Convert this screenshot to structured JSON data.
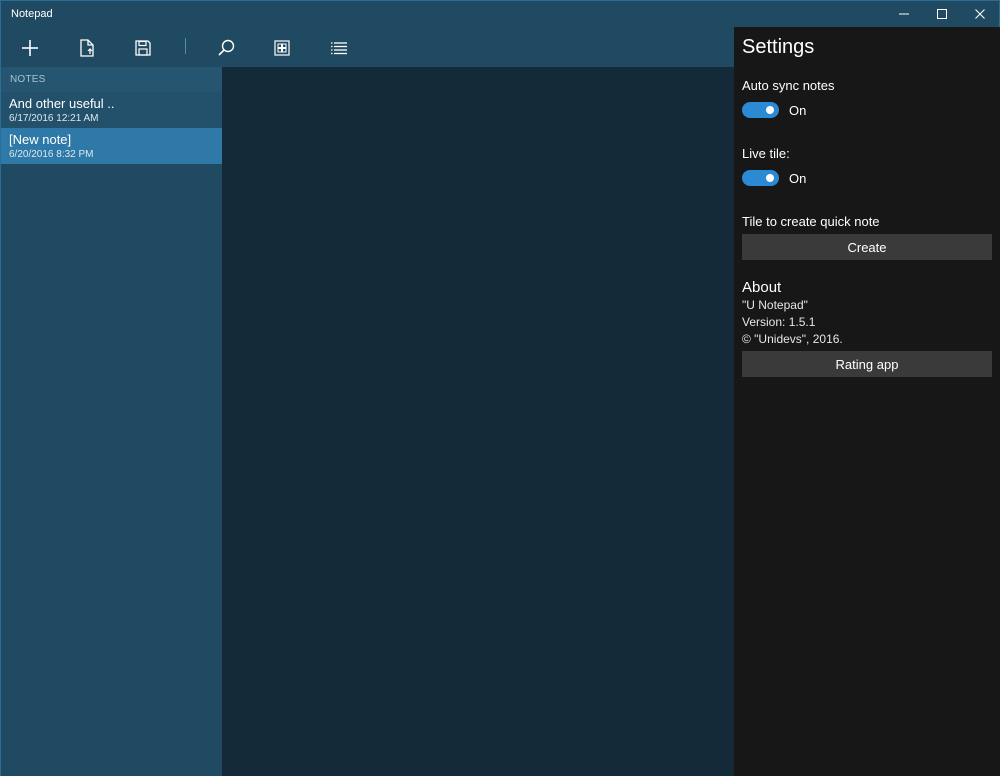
{
  "window": {
    "title": "Notepad"
  },
  "caption": {
    "minimize_icon": "minimize-icon",
    "maximize_icon": "maximize-icon",
    "close_icon": "close-icon"
  },
  "toolbar": {
    "buttons": [
      {
        "icon": "plus-icon"
      },
      {
        "icon": "open-file-icon"
      },
      {
        "icon": "save-icon"
      },
      {
        "icon": "search-icon"
      },
      {
        "icon": "select-all-icon"
      },
      {
        "icon": "list-icon"
      }
    ]
  },
  "notes": {
    "header": "NOTES",
    "items": [
      {
        "title": "And other useful ..",
        "date": "6/17/2016 12:21 AM"
      },
      {
        "title": "[New note]",
        "date": "6/20/2016 8:32 PM"
      }
    ]
  },
  "settings": {
    "title": "Settings",
    "auto_sync_label": "Auto sync notes",
    "auto_sync_state": "On",
    "live_tile_label": "Live tile:",
    "live_tile_state": "On",
    "quick_note_label": "Tile to create quick note",
    "create_button": "Create",
    "about_title": "About",
    "about_name": "\"U Notepad\"",
    "about_version": "Version: 1.5.1",
    "about_copyright": "© \"Unidevs\", 2016.",
    "rating_button": "Rating app"
  },
  "colors": {
    "accent": "#2e79a7",
    "toggle_on": "#2a8ad4",
    "pane_background": "#1f4a62",
    "editor_background": "#142a38",
    "settings_background": "#171717"
  }
}
